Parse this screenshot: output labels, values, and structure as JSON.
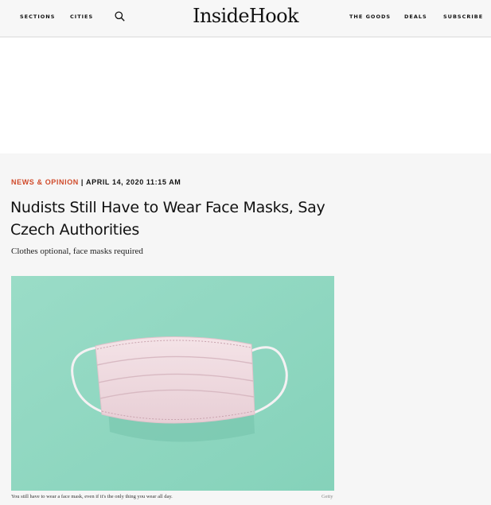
{
  "nav": {
    "sections": "SECTIONS",
    "cities": "CITIES",
    "the_goods": "THE GOODS",
    "deals": "DEALS",
    "subscribe": "SUBSCRIBE"
  },
  "brand": {
    "logo_text": "InsideHook"
  },
  "icons": {
    "search": "search-icon"
  },
  "article": {
    "category": "NEWS & OPINION",
    "separator": "|",
    "date": "APRIL 14, 2020 11:15 AM",
    "title": "Nudists Still Have to Wear Face Masks, Say Czech Authorities",
    "dek": "Clothes optional, face masks required",
    "image_caption": "You still have to wear a face mask, even if it's the only thing you wear all day.",
    "image_credit": "Getty"
  },
  "colors": {
    "accent": "#d04a2a",
    "image_background": "#8fd8c1",
    "mask": "#f1dde2"
  }
}
